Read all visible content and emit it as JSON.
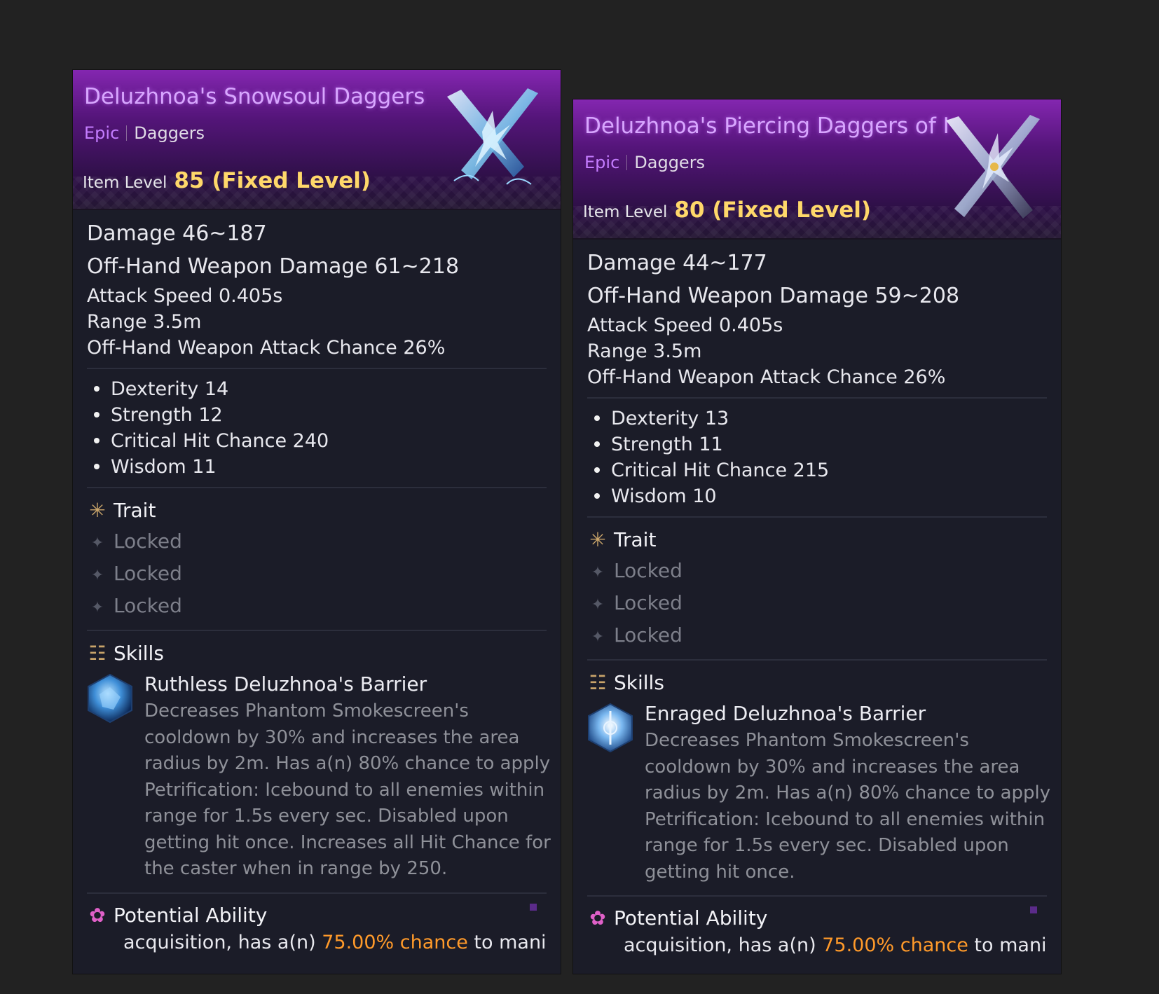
{
  "cards": [
    {
      "name": "Deluzhnoa's Snowsoul Daggers",
      "rarity": "Epic",
      "type": "Daggers",
      "item_level_label": "Item Level",
      "item_level_value": "85 (Fixed Level)",
      "damage": "Damage  46~187",
      "offhand_damage": "Off-Hand Weapon Damage  61~218",
      "attack_speed": "Attack Speed  0.405s",
      "range": "Range  3.5m",
      "offhand_chance": "Off-Hand Weapon Attack Chance  26%",
      "bonuses": [
        "Dexterity 14",
        "Strength 12",
        "Critical Hit Chance 240",
        "Wisdom 11"
      ],
      "trait_title": "Trait",
      "traits": [
        "Locked",
        "Locked",
        "Locked"
      ],
      "skills_title": "Skills",
      "skill_name": "Ruthless Deluzhnoa's Barrier",
      "skill_desc": [
        "Decreases Phantom Smokescreen's",
        "cooldown by 30% and increases the area",
        "radius by 2m. Has a(n) 80% chance to apply",
        "Petrification: Icebound to all enemies within",
        "range for 1.5s every sec. Disabled upon",
        "getting hit once. Increases all Hit Chance for",
        "the caster when in range by 250."
      ],
      "potential_title": "Potential Ability",
      "potential_pre": "acquisition, has a(n) ",
      "potential_highlight": "75.00% chance",
      "potential_post": " to manifest a"
    },
    {
      "name": "Deluzhnoa's Piercing Daggers of I",
      "rarity": "Epic",
      "type": "Daggers",
      "item_level_label": "Item Level",
      "item_level_value": "80 (Fixed Level)",
      "damage": "Damage  44~177",
      "offhand_damage": "Off-Hand Weapon Damage  59~208",
      "attack_speed": "Attack Speed  0.405s",
      "range": "Range  3.5m",
      "offhand_chance": "Off-Hand Weapon Attack Chance  26%",
      "bonuses": [
        "Dexterity 13",
        "Strength 11",
        "Critical Hit Chance 215",
        "Wisdom 10"
      ],
      "trait_title": "Trait",
      "traits": [
        "Locked",
        "Locked",
        "Locked"
      ],
      "skills_title": "Skills",
      "skill_name": "Enraged Deluzhnoa's Barrier",
      "skill_desc": [
        "Decreases Phantom Smokescreen's",
        "cooldown by 30% and increases the area",
        "radius by 2m. Has a(n) 80% chance to apply",
        "Petrification: Icebound to all enemies within",
        "range for 1.5s every sec. Disabled upon",
        "getting hit once."
      ],
      "potential_title": "Potential Ability",
      "potential_pre": "acquisition, has a(n) ",
      "potential_highlight": "75.00% chance",
      "potential_post": " to manifest"
    }
  ],
  "colors": {
    "rarity_epic": "#c47cff",
    "item_name": "#d8a6ff",
    "item_level_value": "#ffd86a",
    "highlight": "#ff9a2a",
    "background": "#222222"
  },
  "icons": {
    "trait": "trait-star-icon",
    "trait_locked": "locked-star-icon",
    "skills": "skills-icon",
    "potential": "potential-gear-icon",
    "weapon": "crossed-daggers-icon",
    "skill1": "ice-barrier-skill-icon",
    "skill2": "enraged-barrier-skill-icon"
  }
}
